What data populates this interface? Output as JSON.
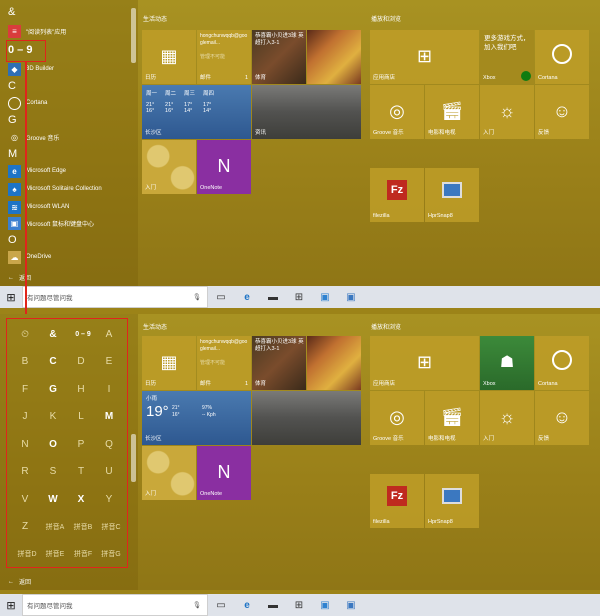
{
  "top": {
    "groups": [
      "&",
      "0 – 9",
      "C",
      "G",
      "M",
      "O"
    ],
    "apps": [
      "\"阅读列表\"应用",
      "3D Builder",
      "Cortana",
      "Groove 音乐",
      "Microsoft Edge",
      "Microsoft Solitaire Collection",
      "Microsoft WLAN",
      "Microsoft 鼠标和键盘中心",
      "OneDrive"
    ],
    "back_label": "返回"
  },
  "sections": {
    "life": "生活动态",
    "play": "播放和浏览"
  },
  "tiles": {
    "calendar": "日历",
    "mail": "邮件",
    "mail_count": "1",
    "mail_account": "hongchunwqqb@googlemail...",
    "mail_note": "管理不可能",
    "sports": "体育",
    "sports_headline": "恭喜霸小贝进3球 英超打入3-1",
    "weather_city": "长沙区",
    "weather_days": [
      "周一",
      "周二",
      "周三",
      "周四"
    ],
    "weather_highs": [
      "21°",
      "21°",
      "17°",
      "17°"
    ],
    "weather_lows": [
      "16°",
      "16°",
      "14°",
      "14°"
    ],
    "news": "资讯",
    "getstarted": "入门",
    "onenote": "OneNote",
    "store": "应用商店",
    "xbox": "Xbox",
    "xbox_promo": "更多游戏方式，加入我们吧",
    "cortana": "Cortana",
    "groove": "Groove 音乐",
    "movies": "电影和电视",
    "tips": "入门",
    "feedback": "反馈",
    "filezilla": "filezilla",
    "hprsnap": "HprSnap8"
  },
  "weather2": {
    "condition": "小雨",
    "temp": "19°",
    "high": "21°",
    "low": "16°",
    "humidity": "97%",
    "wind": "-- Kph"
  },
  "search": {
    "placeholder": "有问题尽管问我"
  },
  "jump": {
    "rows": [
      [
        "⏲",
        "&",
        "0 – 9",
        "A"
      ],
      [
        "B",
        "C",
        "D",
        "E"
      ],
      [
        "F",
        "G",
        "H",
        "I"
      ],
      [
        "J",
        "K",
        "L",
        "M"
      ],
      [
        "N",
        "O",
        "P",
        "Q"
      ],
      [
        "R",
        "S",
        "T",
        "U"
      ],
      [
        "V",
        "W",
        "X",
        "Y"
      ],
      [
        "Z",
        "拼音A",
        "拼音B",
        "拼音C"
      ],
      [
        "拼音D",
        "拼音E",
        "拼音F",
        "拼音G"
      ]
    ],
    "active": [
      "&",
      "0 – 9",
      "C",
      "G",
      "M",
      "O",
      "W",
      "X"
    ]
  },
  "colors": {
    "accent": "#b8981c",
    "highlight": "#e0251b",
    "onenote": "#8a2fa1",
    "xbox": "#107c10"
  }
}
